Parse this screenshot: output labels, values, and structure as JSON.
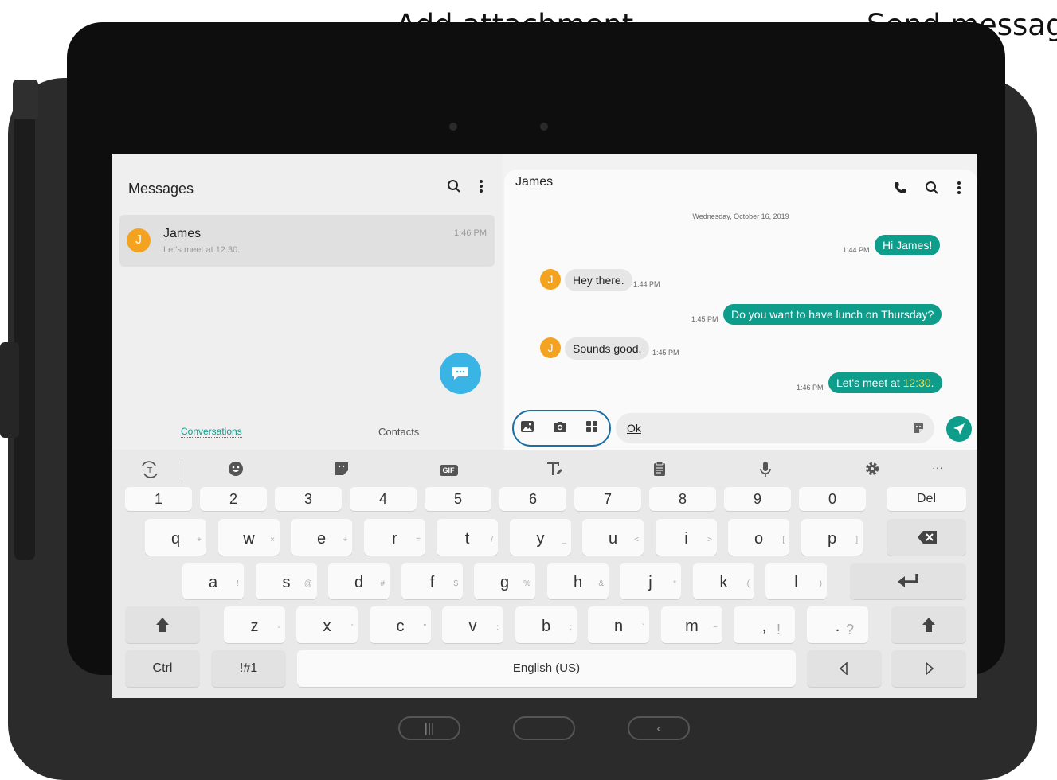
{
  "callouts": {
    "add_attachment": "Add attachment",
    "send_message": "Send message"
  },
  "messages_list": {
    "title": "Messages",
    "conversation": {
      "avatar": "J",
      "name": "James",
      "preview": "Let's meet at 12:30.",
      "time": "1:46 PM"
    },
    "tabs": [
      "Conversations",
      "Contacts"
    ]
  },
  "chat": {
    "contact": "James",
    "date": "Wednesday, October 16, 2019",
    "messages": [
      {
        "dir": "out",
        "text": "Hi James!",
        "time": "1:44 PM"
      },
      {
        "dir": "in",
        "avatar": "J",
        "text": "Hey there.",
        "time": "1:44 PM"
      },
      {
        "dir": "out",
        "text": "Do you want to have lunch on Thursday?",
        "time": "1:45 PM"
      },
      {
        "dir": "in",
        "avatar": "J",
        "text": "Sounds good.",
        "time": "1:45 PM"
      },
      {
        "dir": "out",
        "text_prefix": "Let's meet at ",
        "link": "12:30",
        "text_suffix": ".",
        "time": "1:46 PM"
      }
    ],
    "input_value": "Ok"
  },
  "keyboard": {
    "number_row": [
      "1",
      "2",
      "3",
      "4",
      "5",
      "6",
      "7",
      "8",
      "9",
      "0"
    ],
    "del": "Del",
    "row1": [
      {
        "k": "q",
        "a": "+"
      },
      {
        "k": "w",
        "a": "×"
      },
      {
        "k": "e",
        "a": "÷"
      },
      {
        "k": "r",
        "a": "="
      },
      {
        "k": "t",
        "a": "/"
      },
      {
        "k": "y",
        "a": "_"
      },
      {
        "k": "u",
        "a": "<"
      },
      {
        "k": "i",
        "a": ">"
      },
      {
        "k": "o",
        "a": "["
      },
      {
        "k": "p",
        "a": "]"
      }
    ],
    "row2": [
      {
        "k": "a",
        "a": "!"
      },
      {
        "k": "s",
        "a": "@"
      },
      {
        "k": "d",
        "a": "#"
      },
      {
        "k": "f",
        "a": "$"
      },
      {
        "k": "g",
        "a": "%"
      },
      {
        "k": "h",
        "a": "&"
      },
      {
        "k": "j",
        "a": "*"
      },
      {
        "k": "k",
        "a": "("
      },
      {
        "k": "l",
        "a": ")"
      }
    ],
    "row3": [
      {
        "k": "z",
        "a": "-"
      },
      {
        "k": "x",
        "a": "'"
      },
      {
        "k": "c",
        "a": "\""
      },
      {
        "k": "v",
        "a": ":"
      },
      {
        "k": "b",
        "a": ";"
      },
      {
        "k": "n",
        "a": "`"
      },
      {
        "k": "m",
        "a": "~"
      },
      {
        "k": ",",
        "a": "!"
      },
      {
        "k": ".",
        "a": "?"
      }
    ],
    "ctrl": "Ctrl",
    "symbols": "!#1",
    "space": "English (US)",
    "gif": "GIF",
    "more": "···"
  },
  "colors": {
    "accent": "#0e9c8b",
    "fab": "#3ab4e4",
    "avatar": "#f3a320",
    "callout_line": "#1a6fa5"
  }
}
